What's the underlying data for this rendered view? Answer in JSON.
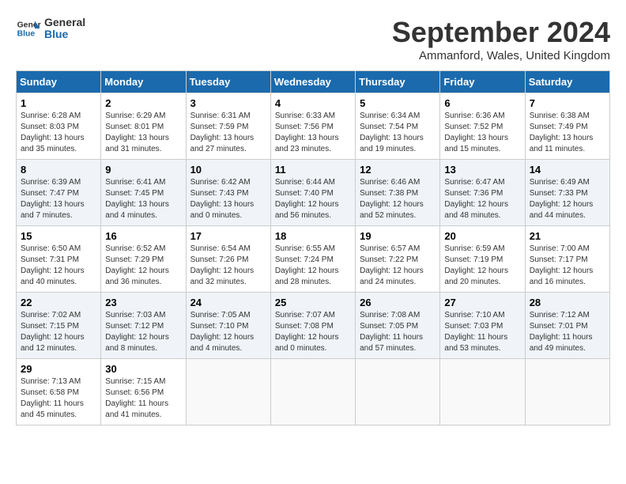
{
  "header": {
    "logo_line1": "General",
    "logo_line2": "Blue",
    "month": "September 2024",
    "location": "Ammanford, Wales, United Kingdom"
  },
  "weekdays": [
    "Sunday",
    "Monday",
    "Tuesday",
    "Wednesday",
    "Thursday",
    "Friday",
    "Saturday"
  ],
  "weeks": [
    [
      {
        "day": "1",
        "info": "Sunrise: 6:28 AM\nSunset: 8:03 PM\nDaylight: 13 hours\nand 35 minutes."
      },
      {
        "day": "2",
        "info": "Sunrise: 6:29 AM\nSunset: 8:01 PM\nDaylight: 13 hours\nand 31 minutes."
      },
      {
        "day": "3",
        "info": "Sunrise: 6:31 AM\nSunset: 7:59 PM\nDaylight: 13 hours\nand 27 minutes."
      },
      {
        "day": "4",
        "info": "Sunrise: 6:33 AM\nSunset: 7:56 PM\nDaylight: 13 hours\nand 23 minutes."
      },
      {
        "day": "5",
        "info": "Sunrise: 6:34 AM\nSunset: 7:54 PM\nDaylight: 13 hours\nand 19 minutes."
      },
      {
        "day": "6",
        "info": "Sunrise: 6:36 AM\nSunset: 7:52 PM\nDaylight: 13 hours\nand 15 minutes."
      },
      {
        "day": "7",
        "info": "Sunrise: 6:38 AM\nSunset: 7:49 PM\nDaylight: 13 hours\nand 11 minutes."
      }
    ],
    [
      {
        "day": "8",
        "info": "Sunrise: 6:39 AM\nSunset: 7:47 PM\nDaylight: 13 hours\nand 7 minutes."
      },
      {
        "day": "9",
        "info": "Sunrise: 6:41 AM\nSunset: 7:45 PM\nDaylight: 13 hours\nand 4 minutes."
      },
      {
        "day": "10",
        "info": "Sunrise: 6:42 AM\nSunset: 7:43 PM\nDaylight: 13 hours\nand 0 minutes."
      },
      {
        "day": "11",
        "info": "Sunrise: 6:44 AM\nSunset: 7:40 PM\nDaylight: 12 hours\nand 56 minutes."
      },
      {
        "day": "12",
        "info": "Sunrise: 6:46 AM\nSunset: 7:38 PM\nDaylight: 12 hours\nand 52 minutes."
      },
      {
        "day": "13",
        "info": "Sunrise: 6:47 AM\nSunset: 7:36 PM\nDaylight: 12 hours\nand 48 minutes."
      },
      {
        "day": "14",
        "info": "Sunrise: 6:49 AM\nSunset: 7:33 PM\nDaylight: 12 hours\nand 44 minutes."
      }
    ],
    [
      {
        "day": "15",
        "info": "Sunrise: 6:50 AM\nSunset: 7:31 PM\nDaylight: 12 hours\nand 40 minutes."
      },
      {
        "day": "16",
        "info": "Sunrise: 6:52 AM\nSunset: 7:29 PM\nDaylight: 12 hours\nand 36 minutes."
      },
      {
        "day": "17",
        "info": "Sunrise: 6:54 AM\nSunset: 7:26 PM\nDaylight: 12 hours\nand 32 minutes."
      },
      {
        "day": "18",
        "info": "Sunrise: 6:55 AM\nSunset: 7:24 PM\nDaylight: 12 hours\nand 28 minutes."
      },
      {
        "day": "19",
        "info": "Sunrise: 6:57 AM\nSunset: 7:22 PM\nDaylight: 12 hours\nand 24 minutes."
      },
      {
        "day": "20",
        "info": "Sunrise: 6:59 AM\nSunset: 7:19 PM\nDaylight: 12 hours\nand 20 minutes."
      },
      {
        "day": "21",
        "info": "Sunrise: 7:00 AM\nSunset: 7:17 PM\nDaylight: 12 hours\nand 16 minutes."
      }
    ],
    [
      {
        "day": "22",
        "info": "Sunrise: 7:02 AM\nSunset: 7:15 PM\nDaylight: 12 hours\nand 12 minutes."
      },
      {
        "day": "23",
        "info": "Sunrise: 7:03 AM\nSunset: 7:12 PM\nDaylight: 12 hours\nand 8 minutes."
      },
      {
        "day": "24",
        "info": "Sunrise: 7:05 AM\nSunset: 7:10 PM\nDaylight: 12 hours\nand 4 minutes."
      },
      {
        "day": "25",
        "info": "Sunrise: 7:07 AM\nSunset: 7:08 PM\nDaylight: 12 hours\nand 0 minutes."
      },
      {
        "day": "26",
        "info": "Sunrise: 7:08 AM\nSunset: 7:05 PM\nDaylight: 11 hours\nand 57 minutes."
      },
      {
        "day": "27",
        "info": "Sunrise: 7:10 AM\nSunset: 7:03 PM\nDaylight: 11 hours\nand 53 minutes."
      },
      {
        "day": "28",
        "info": "Sunrise: 7:12 AM\nSunset: 7:01 PM\nDaylight: 11 hours\nand 49 minutes."
      }
    ],
    [
      {
        "day": "29",
        "info": "Sunrise: 7:13 AM\nSunset: 6:58 PM\nDaylight: 11 hours\nand 45 minutes."
      },
      {
        "day": "30",
        "info": "Sunrise: 7:15 AM\nSunset: 6:56 PM\nDaylight: 11 hours\nand 41 minutes."
      },
      {
        "day": "",
        "info": ""
      },
      {
        "day": "",
        "info": ""
      },
      {
        "day": "",
        "info": ""
      },
      {
        "day": "",
        "info": ""
      },
      {
        "day": "",
        "info": ""
      }
    ]
  ]
}
